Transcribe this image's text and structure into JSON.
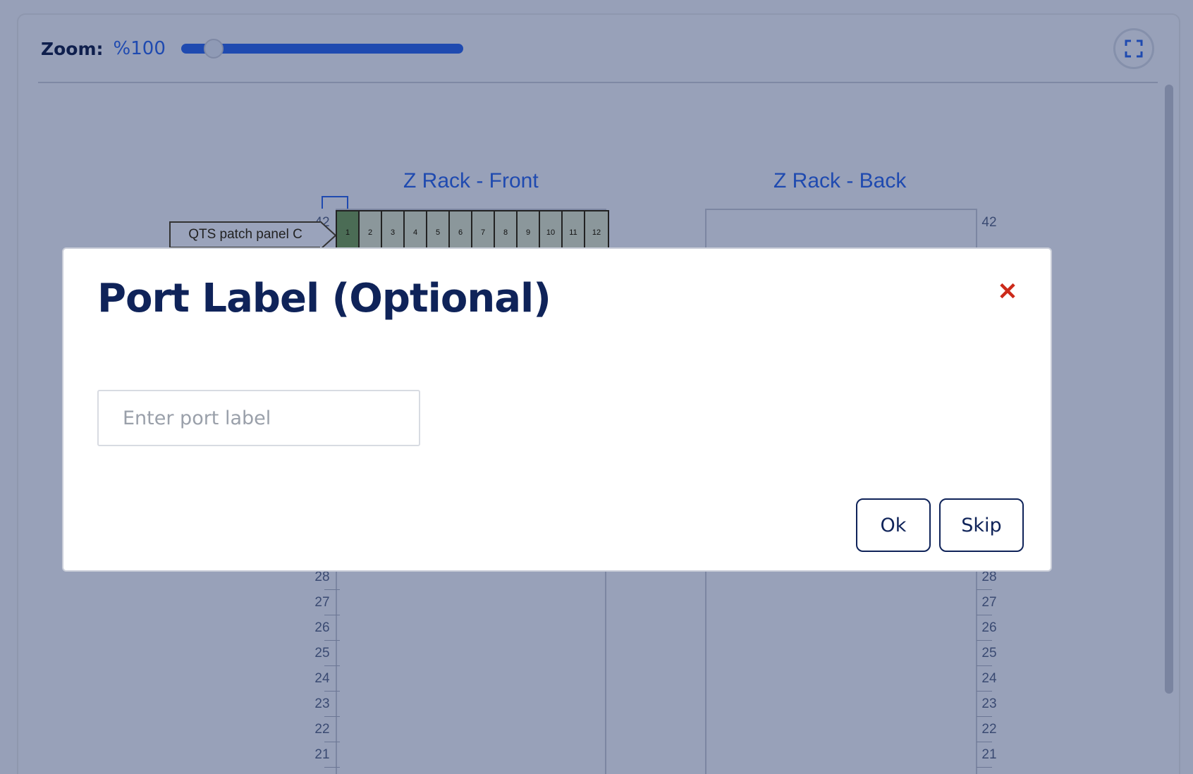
{
  "toolbar": {
    "zoom_label": "Zoom:",
    "zoom_value": "%100",
    "zoom_level_fraction": 0.08,
    "fullscreen_icon": "expand-icon"
  },
  "racks": {
    "front": {
      "title": "Z Rack - Front",
      "device_label": "QTS patch panel C",
      "ports": [
        "1",
        "2",
        "3",
        "4",
        "5",
        "6",
        "7",
        "8",
        "9",
        "10",
        "11",
        "12"
      ],
      "active_port": "1"
    },
    "back": {
      "title": "Z Rack - Back"
    },
    "units_top": [
      "42"
    ],
    "units_bottom": [
      "28",
      "27",
      "26",
      "25",
      "24",
      "23",
      "22",
      "21"
    ]
  },
  "modal": {
    "title": "Port Label (Optional)",
    "input_placeholder": "Enter port label",
    "input_value": "",
    "ok_label": "Ok",
    "skip_label": "Skip",
    "close_icon": "close-icon",
    "colors": {
      "title": "#0f2359",
      "close": "#cc2a1a"
    }
  }
}
